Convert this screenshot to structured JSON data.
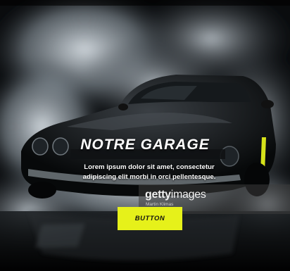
{
  "hero": {
    "title": "NOTRE GARAGE",
    "description": "Lorem ipsum dolor sit amet, consectetur adipiscing elit morbi in orci pellentesque.",
    "button_label": "BUTTON",
    "accent_color": "#e6f11a"
  },
  "watermark": {
    "brand_part1": "getty",
    "brand_part2": "images",
    "credit": "Martin Klimas"
  }
}
